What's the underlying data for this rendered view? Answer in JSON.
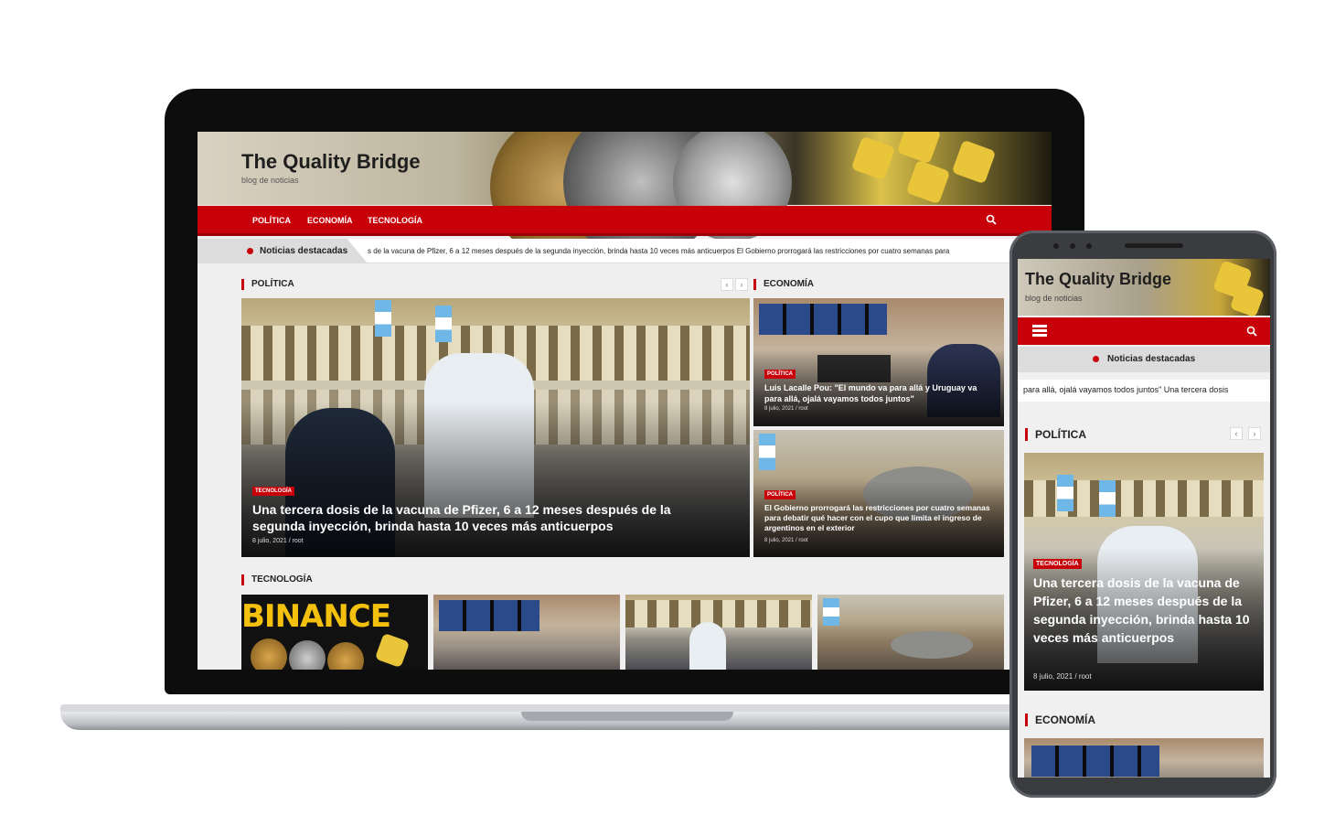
{
  "site": {
    "title": "The Quality Bridge",
    "tagline": "blog de noticias"
  },
  "nav": {
    "items": [
      "Política",
      "Economía",
      "Tecnología"
    ],
    "search_icon": "search-icon"
  },
  "ticker": {
    "label": "Noticias destacadas",
    "text": "s de la vacuna de Pfizer, 6 a 12 meses después de la segunda inyección, brinda hasta 10 veces más anticuerpos          El Gobierno prorrogará las restricciones por cuatro semanas para"
  },
  "sections": {
    "politica": "POLÍTICA",
    "economia": "ECONOMÍA",
    "tecnologia": "TECNOLOGÍA"
  },
  "main_card": {
    "badge": "TECNOLOGÍA",
    "title": "Una tercera dosis de la vacuna de Pfizer, 6 a 12 meses después de la segunda inyección, brinda hasta 10 veces más anticuerpos",
    "meta": "8 julio, 2021 / root"
  },
  "side_cards": [
    {
      "badge": "POLÍTICA",
      "title": "Luis Lacalle Pou: \"El mundo va para allá y Uruguay va para allá, ojalá vayamos todos juntos\"",
      "meta": "8 julio, 2021 / root"
    },
    {
      "badge": "POLÍTICA",
      "title": "El Gobierno prorrogará las restricciones por cuatro semanas para debatir qué hacer con el cupo que limita el ingreso de argentinos en el exterior",
      "meta": "8 julio, 2021 / root"
    }
  ],
  "tech_thumbs": [
    "BINANCE"
  ],
  "phone": {
    "title": "The Quality Bridge",
    "tagline": "blog de noticias",
    "featured_label": "Noticias destacadas",
    "ticker_text": "para allá, ojalá vayamos todos juntos\"      Una tercera dosis",
    "section_politica": "POLÍTICA",
    "section_economia": "ECONOMÍA",
    "card": {
      "badge": "TECNOLOGÍA",
      "title": "Una tercera dosis de la vacuna de Pfizer, 6 a 12 meses después de la segunda inyección, brinda hasta 10 veces más anticuerpos",
      "meta": "8 julio, 2021 / root"
    }
  },
  "colors": {
    "brand_red": "#c8000a",
    "laptop_frame": "#0d0d0d",
    "phone_frame": "#3a3c40"
  },
  "carousel_arrows": {
    "prev": "‹",
    "next": "›"
  }
}
